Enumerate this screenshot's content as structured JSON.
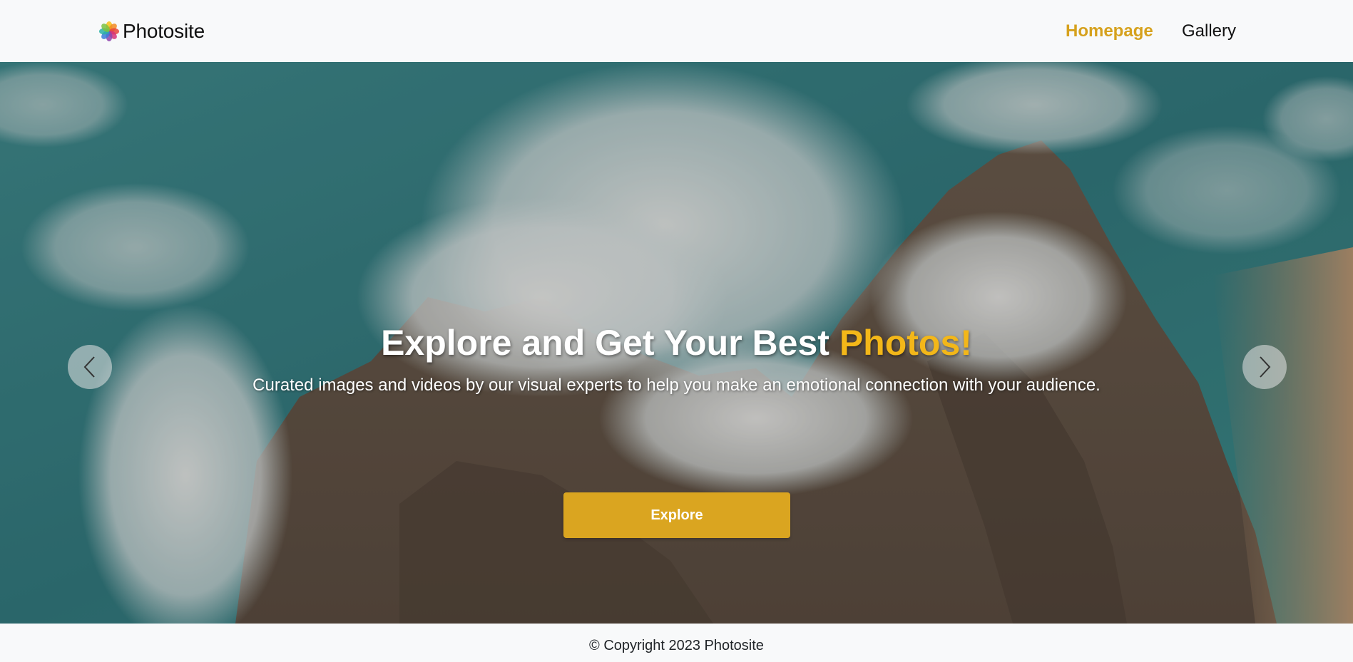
{
  "navbar": {
    "brand_name": "Photosite",
    "brand_icon": "flower-logo-icon",
    "links": [
      {
        "label": "Homepage",
        "active": true
      },
      {
        "label": "Gallery",
        "active": false
      }
    ]
  },
  "hero": {
    "background": "aerial-ocean-waves-rocks-photo",
    "title_main": "Explore and Get Your Best ",
    "title_accent": "Photos!",
    "subtitle": "Curated images and videos by our visual experts to help you make an emotional connection with your audience.",
    "cta_label": "Explore",
    "prev_icon": "chevron-left-icon",
    "next_icon": "chevron-right-icon"
  },
  "footer": {
    "copyright": "© Copyright 2023 Photosite"
  },
  "colors": {
    "accent": "#daa520",
    "title_accent": "#f3b719",
    "nav_active": "#d6a11d",
    "background": "#f8f9fa"
  }
}
